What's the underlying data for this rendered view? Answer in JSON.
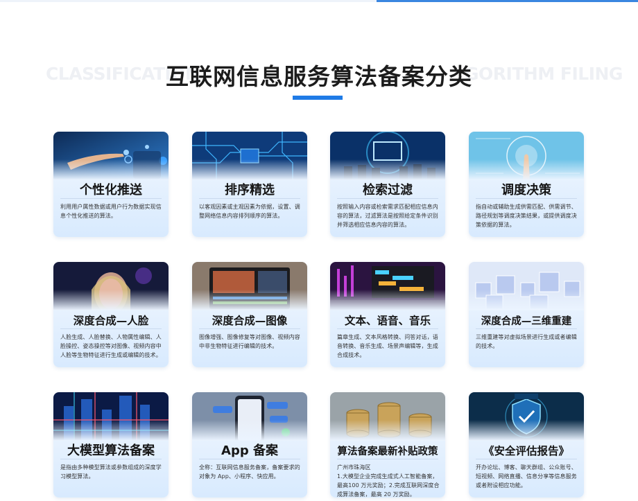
{
  "header": {
    "title": "互联网信息服务算法备案分类",
    "bg_left": "CLASSIFICATION",
    "bg_right": "GORITHM FILING"
  },
  "colors": {
    "accent": "#1f7be6",
    "title": "#1c1c1c",
    "card_bg": "#e6f1fe"
  },
  "cards": [
    {
      "title": "个性化推送",
      "icon": "touch-screen-image",
      "desc": "利用用户属性数据或用户行为数据实现信息个性化推送的算法。"
    },
    {
      "title": "排序精选",
      "icon": "circuit-board-image",
      "desc": "以客观因素或主观因素为依据，设置、调整网络信息内容排列顺序的算法。"
    },
    {
      "title": "检索过滤",
      "icon": "search-monitor-image",
      "desc": "按照输入内容或检索需求匹配相应信息内容的算法，过滤算法是按照给定条件识别并筛选相应信息内容的算法。"
    },
    {
      "title": "调度决策",
      "icon": "decision-touch-image",
      "desc": "指自动或辅助生成供需匹配、供需调节、路径规划等调度决策结果，或提供调度决策依据的算法。"
    },
    {
      "title": "深度合成—人脸",
      "icon": "face-image",
      "desc": "人脸生成、人脸替换、人物属性编辑、人脸操控、姿态操控等对图像、视频内容中人脸等生物特征进行生成或编辑的技术。"
    },
    {
      "title": "深度合成—图像",
      "icon": "image-editing-image",
      "desc": "图像增强、图像修复等对图像、视频内容中非生物特征进行编辑的技术。"
    },
    {
      "title": "文本、语音、音乐",
      "icon": "audio-mixing-image",
      "desc": "篇章生成、文本风格转换、问答对话，语音转换、音乐生成、场景声编辑等，生成合成技术。"
    },
    {
      "title": "深度合成—三维重建",
      "icon": "3d-cubes-image",
      "desc": "三维重建等对虚拟场景进行生成或者编辑的技术。"
    },
    {
      "title": "大模型算法备案",
      "icon": "data-city-image",
      "desc": "是指由多种模型算法或参数组成的深度学习模型算法。"
    },
    {
      "title": "App 备案",
      "icon": "phone-app-image",
      "desc": "全称：互联网信息服务备案，备案要求的对象为 App、小程序、快应用。"
    },
    {
      "title": "算法备案最新补贴政策",
      "icon": "coins-image",
      "desc_lines": [
        "广州市珠海区",
        "1.大模型企业完成生成式人工智能备案，最高100 万元奖励；2.完成互联网深度合成算法备案，最高 20 万奖励。"
      ]
    },
    {
      "title": "《安全评估报告》",
      "icon": "security-shield-image",
      "desc": "开办论坛、博客、聊天群组、公众账号、短视频、网络直播、信息分享等信息服务或者附设相应功能。"
    }
  ]
}
